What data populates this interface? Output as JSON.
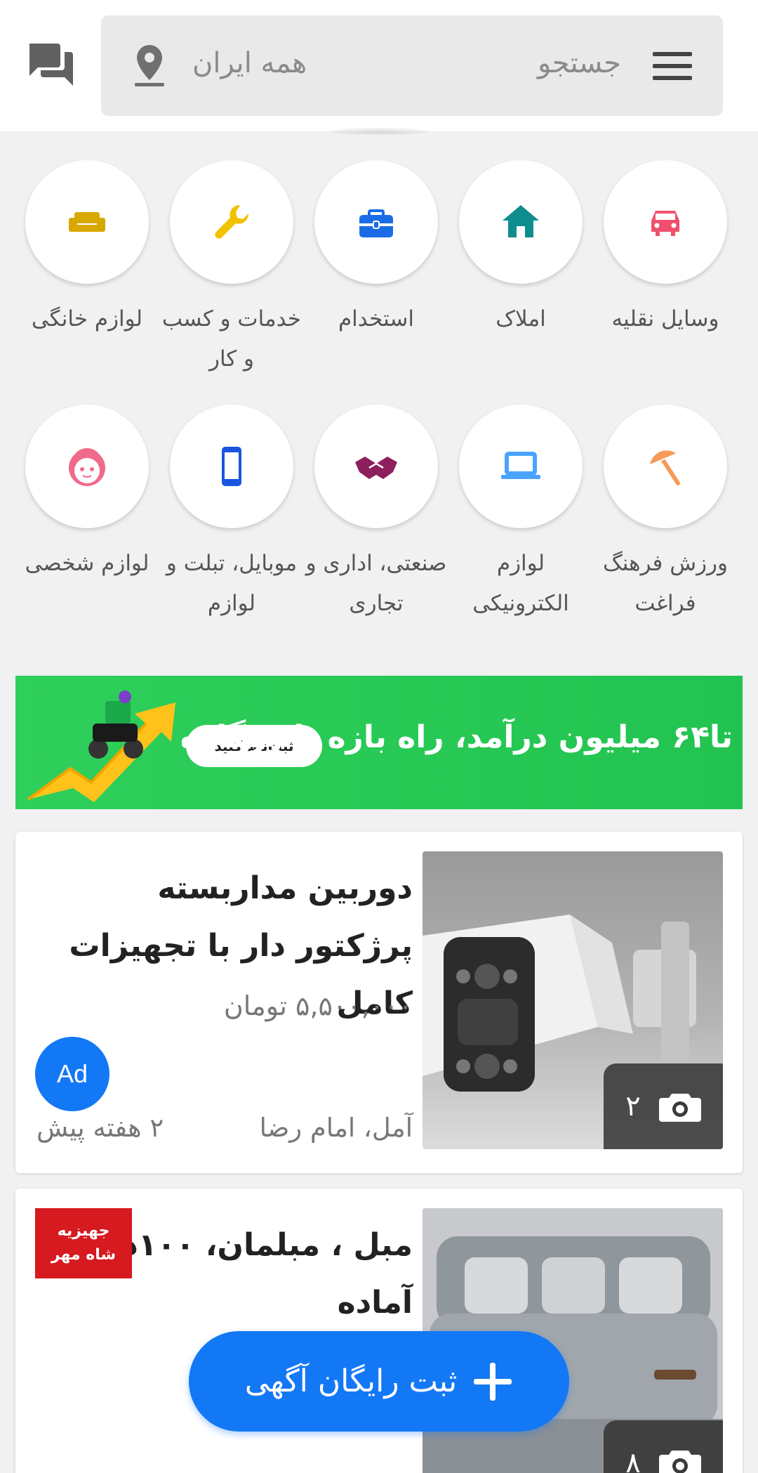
{
  "header": {
    "search_placeholder": "جستجو",
    "location_label": "همه ایران",
    "icons": [
      "menu-icon",
      "location-pin-icon",
      "chat-icon"
    ]
  },
  "categories": [
    {
      "label": "وسایل نقلیه",
      "icon": "car-icon",
      "color": "#f0506e"
    },
    {
      "label": "املاک",
      "icon": "home-icon",
      "color": "#0f8d8d"
    },
    {
      "label": "استخدام",
      "icon": "briefcase-icon",
      "color": "#1a6ce6"
    },
    {
      "label": "خدمات و کسب و کار",
      "icon": "wrench-icon",
      "color": "#f2c200"
    },
    {
      "label": "لوازم خانگی",
      "icon": "sofa-icon",
      "color": "#d8a800"
    },
    {
      "label": "ورزش فرهنگ فراغت",
      "icon": "umbrella-icon",
      "color": "#f59a57"
    },
    {
      "label": "لوازم الکترونیکی",
      "icon": "laptop-icon",
      "color": "#4aa3ff"
    },
    {
      "label": "صنعتی، اداری و تجاری",
      "icon": "handshake-icon",
      "color": "#8e1f5e"
    },
    {
      "label": "موبایل، تبلت و لوازم",
      "icon": "phone-icon",
      "color": "#1a55e0"
    },
    {
      "label": "لوازم شخصی",
      "icon": "face-icon",
      "color": "#f06b8a"
    }
  ],
  "banner": {
    "headline": "تا۶۴ میلیون درآمد، راه بازه پا روگازه",
    "button_label": "ثبت‌نام کنید",
    "background": "#27c855"
  },
  "listings": [
    {
      "title": "دوربین مداربسته پرژکتور دار با تجهیزات کامل",
      "price": "۵,۵۰۰,۰۰۰ تومان",
      "location": "آمل، امام رضا",
      "time": "۲ هفته پیش",
      "photo_count": "۲",
      "badge": "Ad"
    },
    {
      "title": "مبل ، مبلمان، ۱۰۰دست آماده",
      "photo_count": "۸",
      "shop_logo_line1": "جهیزیه",
      "shop_logo_line2": "شاه مهر"
    }
  ],
  "fab": {
    "label": "ثبت رایگان آگهی",
    "color": "#1378f5"
  }
}
